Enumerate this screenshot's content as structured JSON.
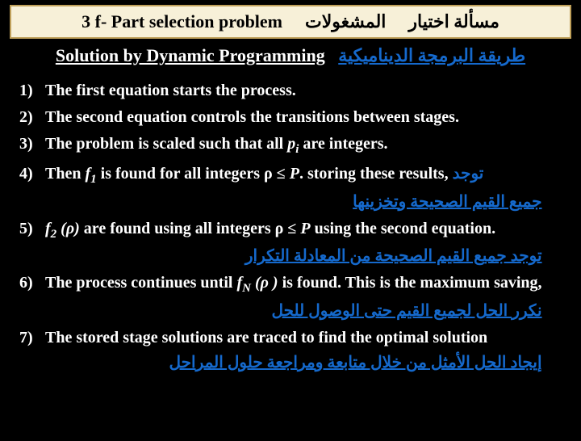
{
  "title": {
    "left": "3 f- Part selection problem",
    "mid": "المشغولات",
    "right": "مسألة اختيار"
  },
  "subtitle": {
    "eng": "Solution by Dynamic Programming",
    "ar": "طريقة البرمجة الديناميكية"
  },
  "items": [
    {
      "n": "1)",
      "text": "The first equation starts the process."
    },
    {
      "n": "2)",
      "text": "The second equation controls the transitions between stages."
    },
    {
      "n": "3)",
      "pre": "The problem is scaled such that all ",
      "sym1": "p",
      "sub1": "i",
      "post": " are integers."
    },
    {
      "n": "4)",
      "pre": "Then ",
      "sym1": "f",
      "sub1": "1",
      "mid": " is found for all integers ρ ≤ ",
      "sym2": "P",
      "post": ". storing these results,",
      "ar_inline": " توجد",
      "sub_ar": "جميع القيم الصحيحة وتخزينها"
    },
    {
      "n": "5)",
      "sym1": "f",
      "sub1": "2",
      "mid2": " (ρ)",
      "post1": " are found using all integers ρ ≤ ",
      "sym2": "P",
      "post2": " using the second equation.",
      "sub_ar": "توجد جميع القيم الصحيحة  من المعادلة التكرار"
    },
    {
      "n": "6)",
      "pre": "The process continues until ",
      "sym1": "f",
      "sub1": "N",
      "mid2": " (ρ )",
      "post": " is found. This is the maximum saving,",
      "sub_ar": "نكرر الحل لجميع القيم حتى الوصول للحل"
    },
    {
      "n": "7)",
      "text": "The stored stage solutions are traced to find the optimal solution",
      "sub_ar": "إيجاد الحل الأمثل من خلال متابعة ومراجعة حلول المراحل"
    }
  ]
}
